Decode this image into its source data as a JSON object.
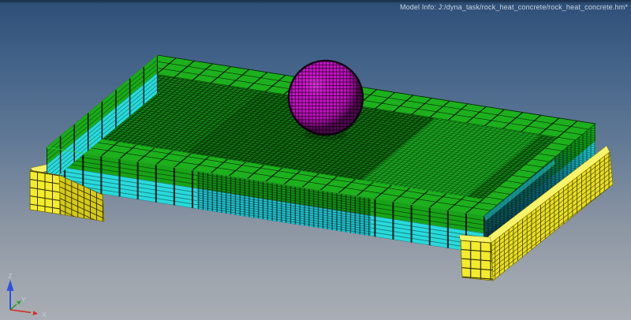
{
  "header": {
    "model_info": "Model Info: J:/dyna_task/rock_heat_concrete/rock_heat_concrete.hm*"
  },
  "axis_triad": {
    "z_label": "Z",
    "y_label": "Y",
    "x_label": "X",
    "z_color": "#3050dd",
    "y_color": "#2da02d",
    "x_color": "#d42a20",
    "label_color": "#c6ccd4"
  },
  "scene": {
    "background_top": "#2e4e76",
    "background_bottom": "#a9adb4",
    "parts": [
      {
        "id": "impactor-sphere",
        "label": "spherical impactor",
        "color": "#cb12cb"
      },
      {
        "id": "slab-top-coarse-band",
        "label": "slab top coarse mesh band",
        "color": "#1cb01c"
      },
      {
        "id": "slab-top-fine-mesh",
        "label": "slab top fine mesh",
        "color": "#108012"
      },
      {
        "id": "slab-cyan-layer",
        "label": "slab lower cyan layer",
        "color": "#28dadc"
      },
      {
        "id": "slab-shadow-end-face",
        "label": "slab right end face (shadowed)",
        "color": "#0a5f66"
      },
      {
        "id": "support-left",
        "label": "left support beam",
        "color": "#f4ec2a"
      },
      {
        "id": "support-right",
        "label": "right support beam",
        "color": "#e9df20"
      }
    ]
  }
}
